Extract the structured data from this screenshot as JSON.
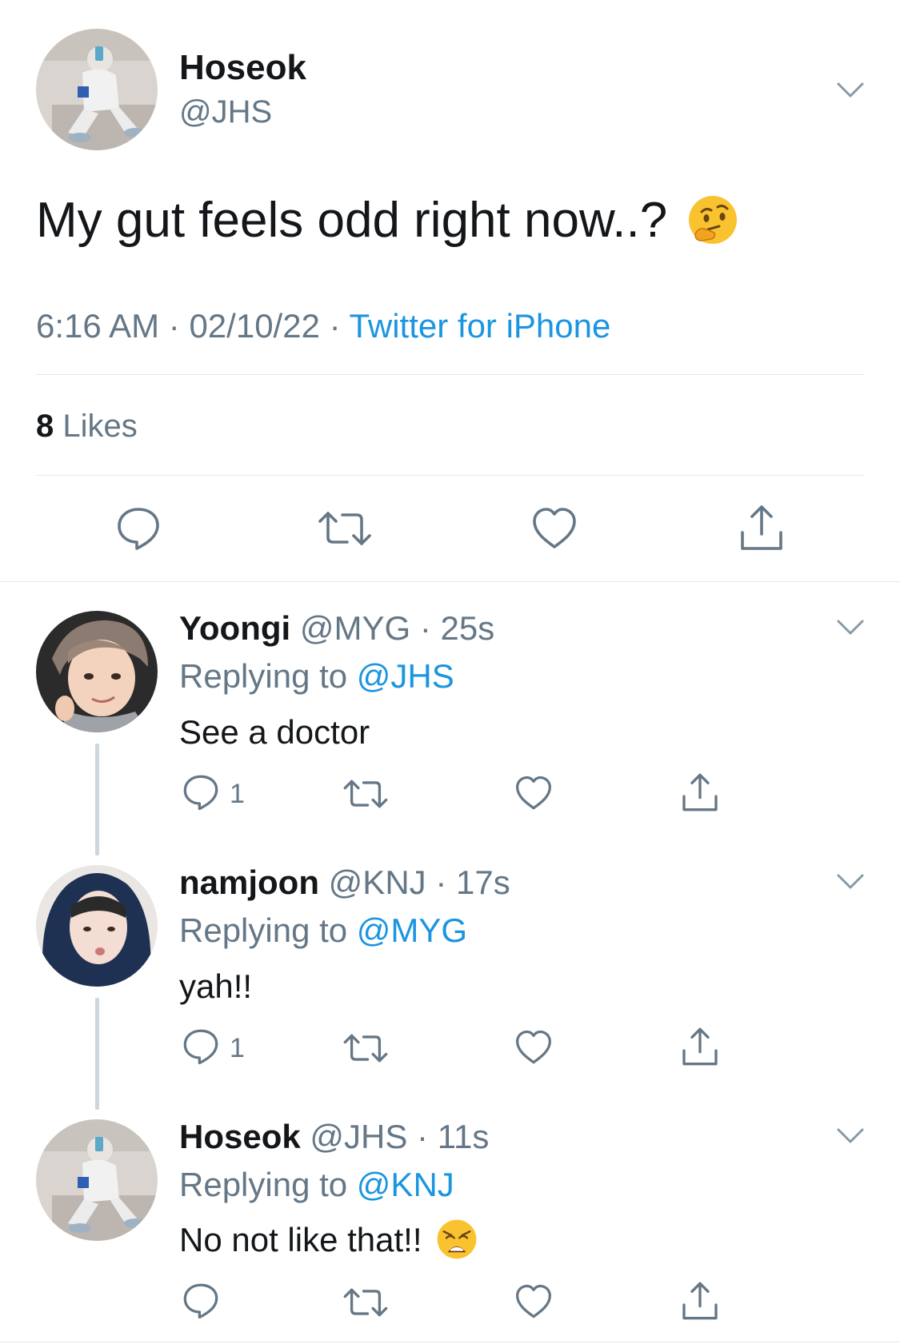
{
  "main_tweet": {
    "name": "Hoseok",
    "handle": "@JHS",
    "text": "My gut feels odd right now..?",
    "emoji_icon": "thinking-face-emoji",
    "time": "6:16 AM",
    "sep1": "·",
    "date": "02/10/22",
    "sep2": "·",
    "source": "Twitter for iPhone",
    "likes_count": "8",
    "likes_label": "Likes"
  },
  "replies": [
    {
      "name": "Yoongi",
      "handle": "@MYG",
      "dot": "·",
      "time": "25s",
      "replying_label": "Replying to",
      "replying_to": "@JHS",
      "text": "See a doctor",
      "reply_count": "1"
    },
    {
      "name": "namjoon",
      "handle": "@KNJ",
      "dot": "·",
      "time": "17s",
      "replying_label": "Replying to",
      "replying_to": "@MYG",
      "text": "yah!!",
      "reply_count": "1"
    },
    {
      "name": "Hoseok",
      "handle": "@JHS",
      "dot": "·",
      "time": "11s",
      "replying_label": "Replying to",
      "replying_to": "@KNJ",
      "text": "No not like that!!",
      "emoji_icon": "weary-face-emoji",
      "reply_count": ""
    }
  ],
  "colors": {
    "link": "#1b95e0",
    "secondary_text": "#657786",
    "divider": "#e1e8ed",
    "thread_line": "#ccd6dd"
  }
}
